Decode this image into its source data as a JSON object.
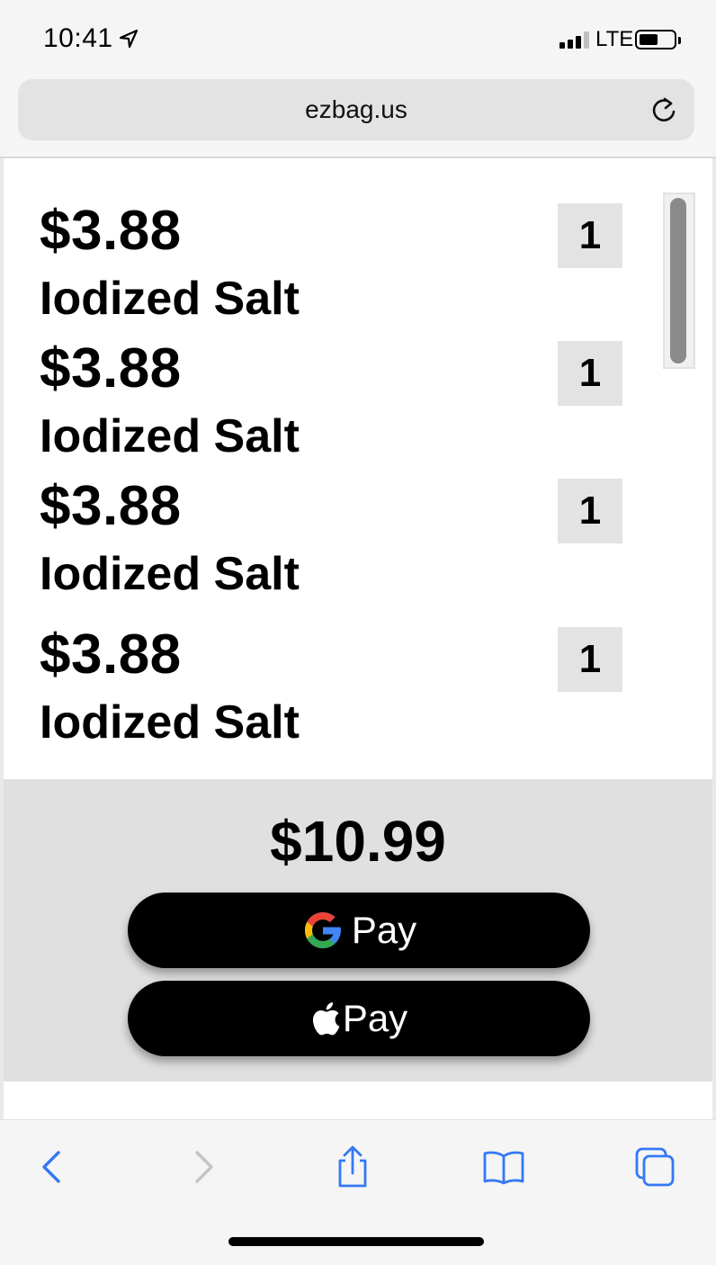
{
  "status_bar": {
    "time": "10:41",
    "network": "LTE",
    "icons": [
      "location-arrow-icon",
      "signal-icon",
      "battery-icon"
    ]
  },
  "browser": {
    "url": "ezbag.us",
    "reload_icon": "reload-icon"
  },
  "cart": {
    "items": [
      {
        "price": "$3.88",
        "name": "Iodized Salt",
        "qty": "1"
      },
      {
        "price": "$3.88",
        "name": "Iodized Salt",
        "qty": "1"
      },
      {
        "price": "$3.88",
        "name": "Iodized Salt",
        "qty": "1"
      },
      {
        "price": "$3.88",
        "name": "Iodized Salt",
        "qty": "1"
      }
    ]
  },
  "checkout": {
    "total": "$10.99",
    "google_pay_label": "Pay",
    "apple_pay_label": "Pay"
  },
  "toolbar": {
    "icons": [
      "back-icon",
      "forward-icon",
      "share-icon",
      "bookmarks-icon",
      "tabs-icon"
    ],
    "accent": "#3478f6",
    "disabled": "#c3c3c8"
  }
}
